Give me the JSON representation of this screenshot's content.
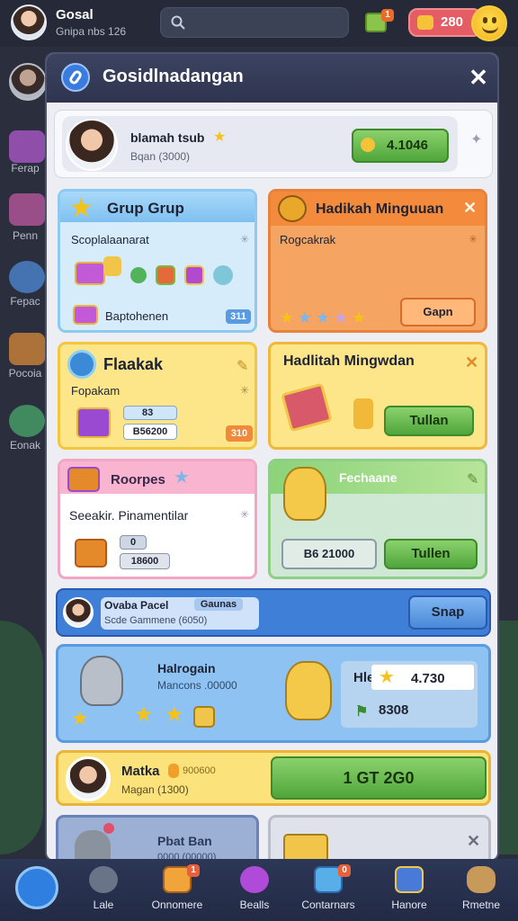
{
  "topbar": {
    "title": "Gosal",
    "subtitle": "Gnipa nbs 126",
    "coins": "280",
    "badge": "1"
  },
  "sidebar": {
    "items": [
      {
        "label": "Ferap"
      },
      {
        "label": "Penn"
      },
      {
        "label": "Fepac"
      },
      {
        "label": "Pocoia"
      },
      {
        "label": "Eonak"
      }
    ]
  },
  "modal": {
    "title": "Gosidlnadangan",
    "close": "✕",
    "profile": {
      "name": "blamah tsub",
      "sub": "Bqan (3000)",
      "button": "4.1046"
    },
    "cards": {
      "grup": {
        "title": "Grup Grup",
        "sub": "Scoplalaanarat",
        "foot": "Baptohenen",
        "tag": "311"
      },
      "hadiah1": {
        "title": "Hadikah Minguuan",
        "sub": "Rogcakrak",
        "button": "Gapn"
      },
      "flaak": {
        "title": "Flaakak",
        "sub": "Fopakam",
        "tag1": "83",
        "tag2": "B56200",
        "tag3": "310"
      },
      "hadiah2": {
        "title": "Hadlitah Mingwdan",
        "button": "Tullan"
      },
      "roorpes": {
        "title": "Roorpes",
        "sub": "Seeakir. Pinamentilar",
        "tag1": "0",
        "tag2": "18600"
      },
      "rechaane": {
        "title": "Fechaane",
        "value": "B6 21000",
        "button": "Tullen"
      }
    },
    "rows": {
      "ovaba": {
        "title": "Ovaba Pacel",
        "tag": "Gaunas",
        "sub": "Scde Gammene (6050)",
        "button": "Snap"
      },
      "halrogan": {
        "title": "Halrogain",
        "sub": "Mancons .00000",
        "k1": "Hle",
        "v1": "4.730",
        "v2": "8308"
      },
      "matka": {
        "title": "Matka",
        "tag": "900600",
        "sub": "Magan (1300)",
        "button": "1 GT 2G0"
      },
      "pbat": {
        "title": "Pbat Ban",
        "sub": "0000 (00000)"
      }
    }
  },
  "nav": {
    "items": [
      {
        "label": ""
      },
      {
        "label": "Lale"
      },
      {
        "label": "Onnomere",
        "badge": "1"
      },
      {
        "label": "Bealls"
      },
      {
        "label": "Contarnars",
        "badge": "0"
      },
      {
        "label": "Hanore"
      },
      {
        "label": "Rmetne"
      }
    ]
  }
}
